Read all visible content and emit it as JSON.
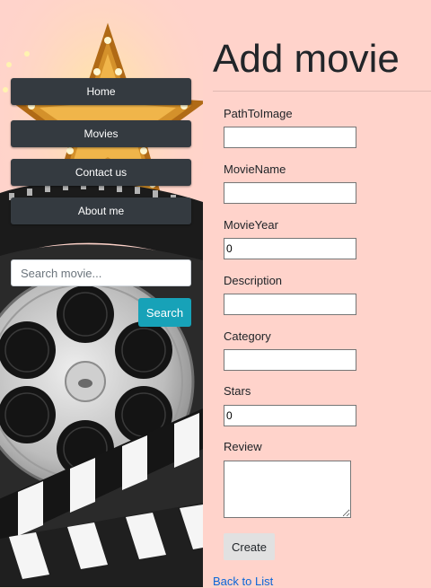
{
  "nav": {
    "items": [
      {
        "label": "Home"
      },
      {
        "label": "Movies"
      },
      {
        "label": "Contact us"
      },
      {
        "label": "About me"
      }
    ]
  },
  "search": {
    "placeholder": "Search movie...",
    "button_label": "Search"
  },
  "page": {
    "title": "Add movie"
  },
  "form": {
    "fields": [
      {
        "label": "PathToImage",
        "value": ""
      },
      {
        "label": "MovieName",
        "value": ""
      },
      {
        "label": "MovieYear",
        "value": "0"
      },
      {
        "label": "Description",
        "value": ""
      },
      {
        "label": "Category",
        "value": ""
      },
      {
        "label": "Stars",
        "value": "0"
      }
    ],
    "review": {
      "label": "Review",
      "value": ""
    },
    "submit_label": "Create"
  },
  "back_link": "Back to List",
  "colors": {
    "background": "#ffd3cb",
    "nav_button": "#343a40",
    "search_button": "#17a2b8",
    "link": "#0a66d8"
  }
}
